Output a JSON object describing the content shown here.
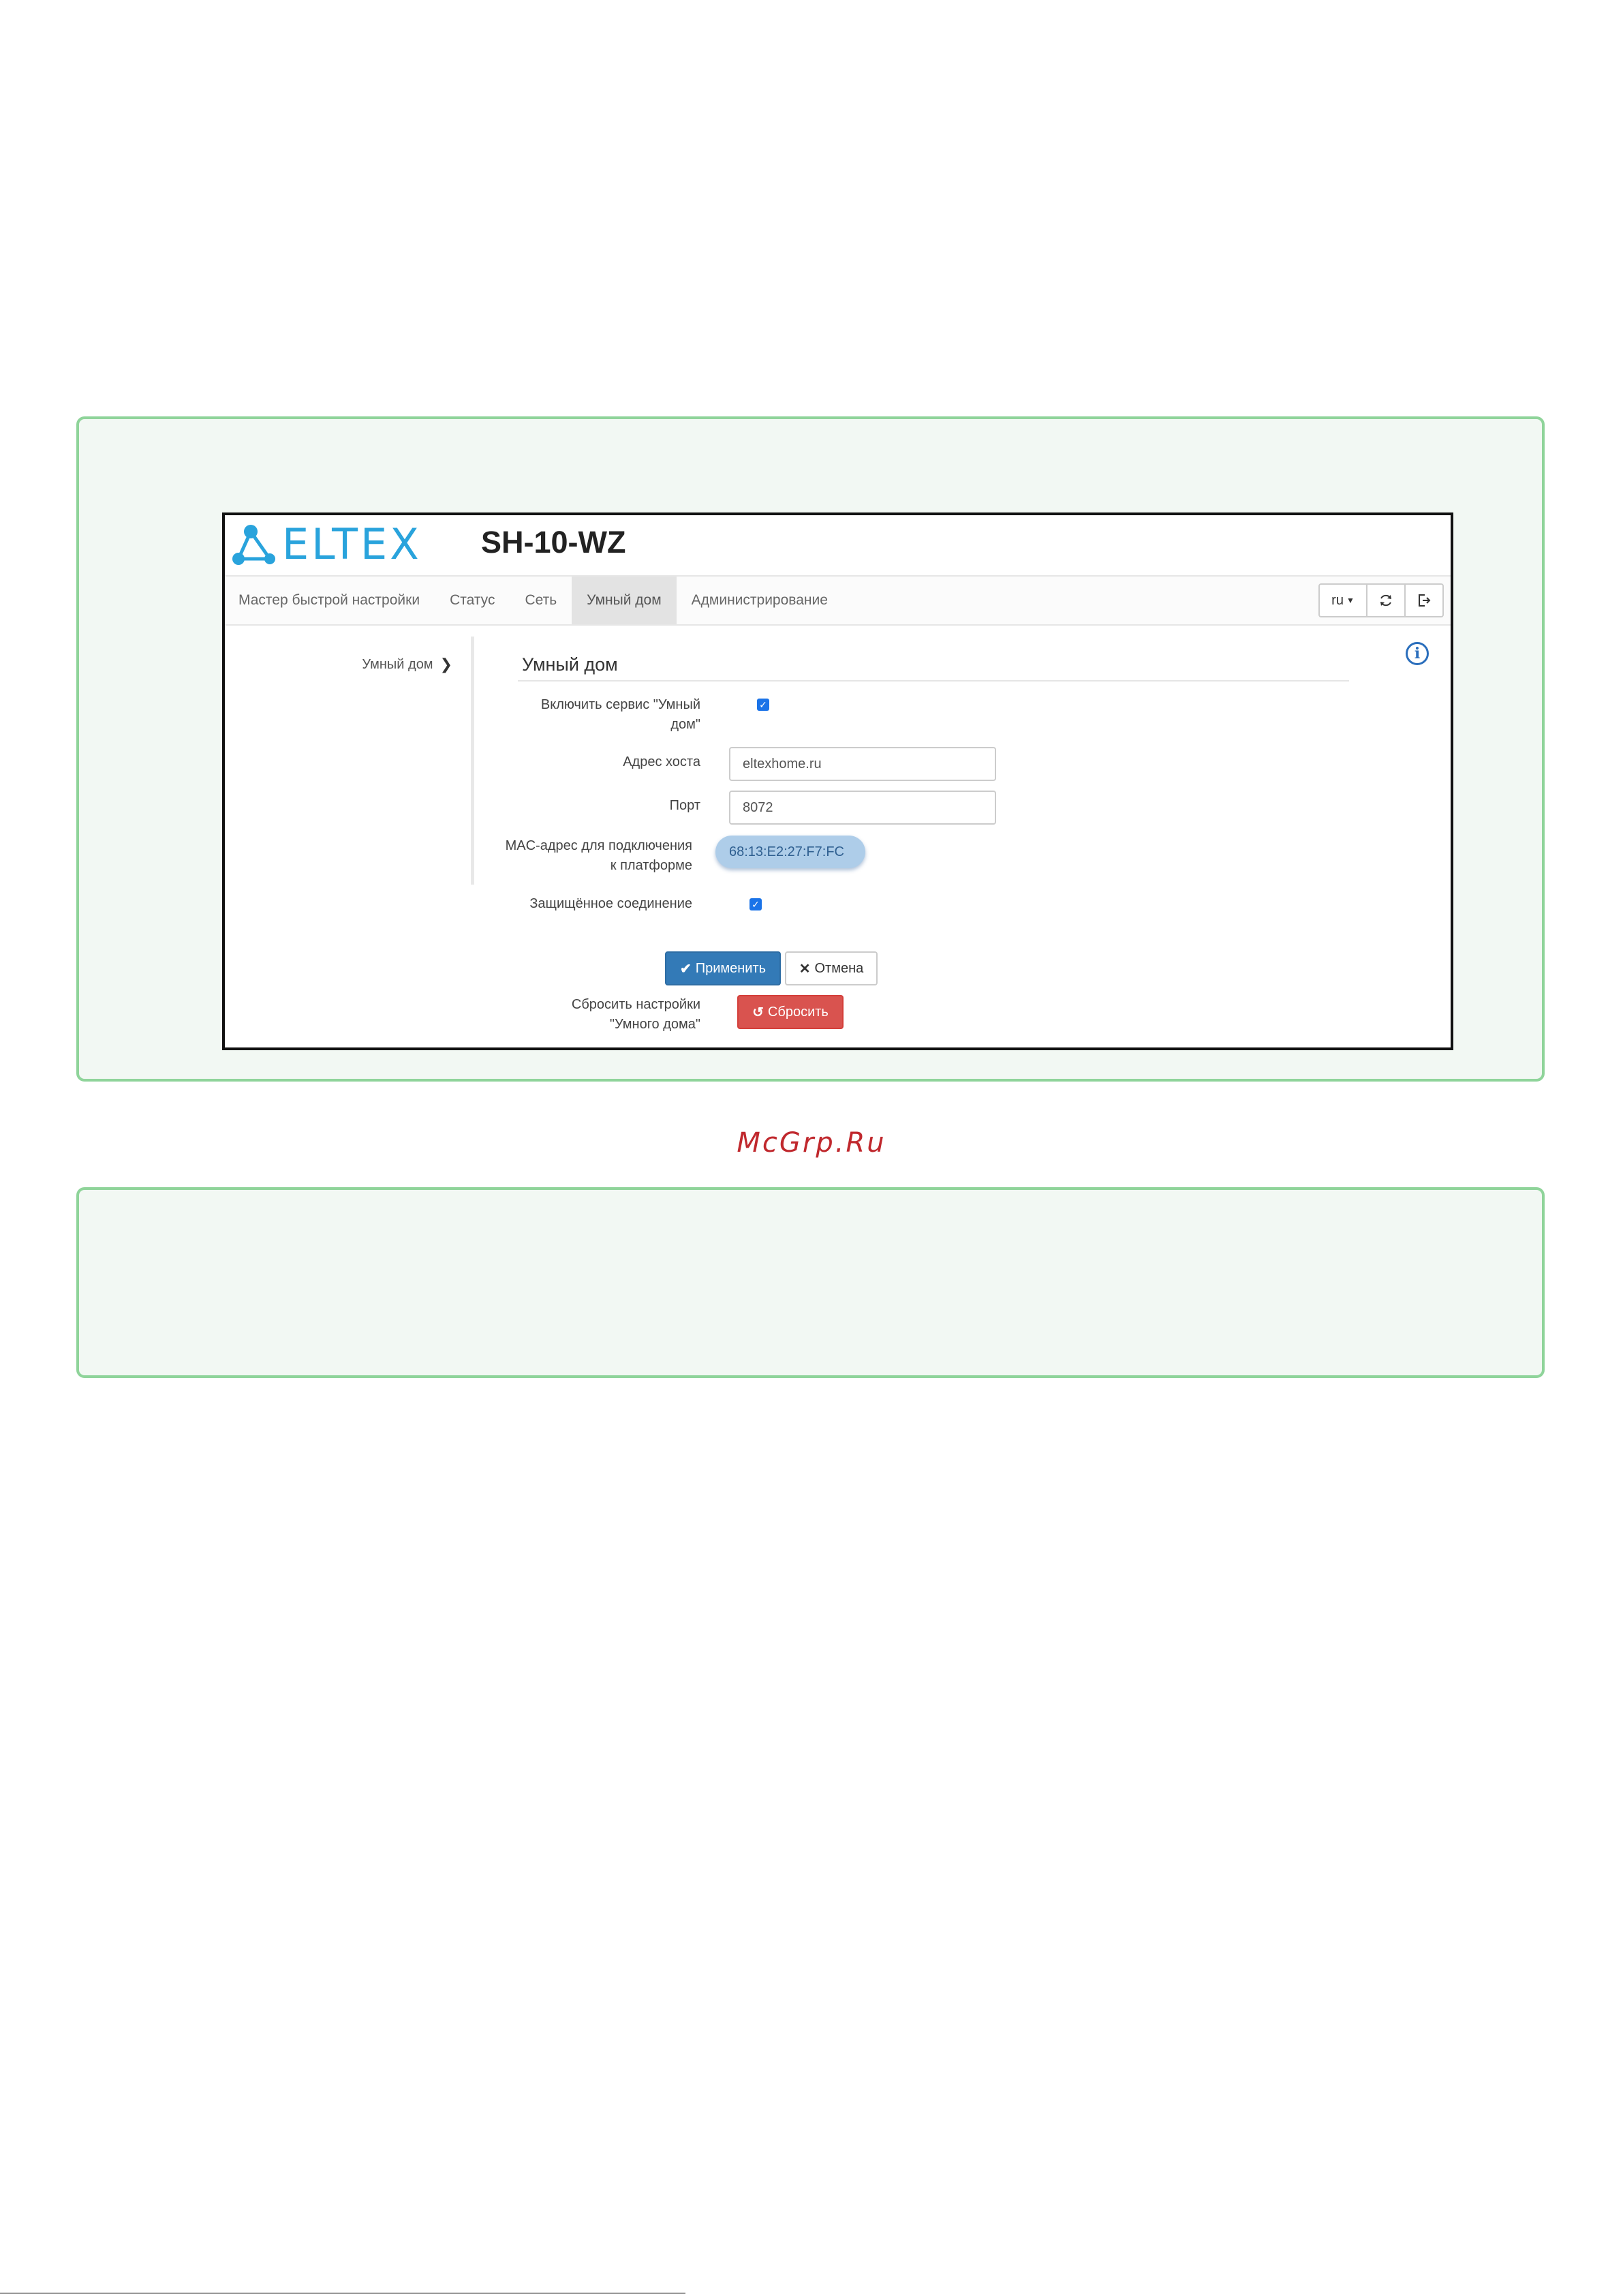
{
  "watermark": "McGrp.Ru",
  "app": {
    "logo_text": "ELTEX",
    "model": "SH-10-WZ"
  },
  "nav": {
    "items": [
      {
        "label": "Мастер быстрой настройки",
        "active": false
      },
      {
        "label": "Статус",
        "active": false
      },
      {
        "label": "Сеть",
        "active": false
      },
      {
        "label": "Умный дом",
        "active": true
      },
      {
        "label": "Администрирование",
        "active": false
      }
    ],
    "lang": "ru",
    "refresh_icon": "refresh-icon",
    "logout_icon": "logout-icon"
  },
  "sidebar": {
    "item_label": "Умный дом"
  },
  "form": {
    "title": "Умный дом",
    "enable_label": "Включить сервис \"Умный дом\"",
    "enable_checked": true,
    "host_label": "Адрес хоста",
    "host_value": "eltexhome.ru",
    "port_label": "Порт",
    "port_value": "8072",
    "mac_label": "MAC-адрес для подключения к платформе",
    "mac_value": "68:13:E2:27:F7:FC",
    "secure_label": "Защищённое соединение",
    "secure_checked": true,
    "apply_label": "Применить",
    "cancel_label": "Отмена",
    "reset_label_text": "Сбросить настройки \"Умного дома\"",
    "reset_button_label": "Сбросить"
  },
  "colors": {
    "accent": "#337ab7",
    "danger": "#d9534f",
    "logo": "#29a3dc",
    "note_border": "#8fd49a",
    "watermark": "#c0282d"
  }
}
